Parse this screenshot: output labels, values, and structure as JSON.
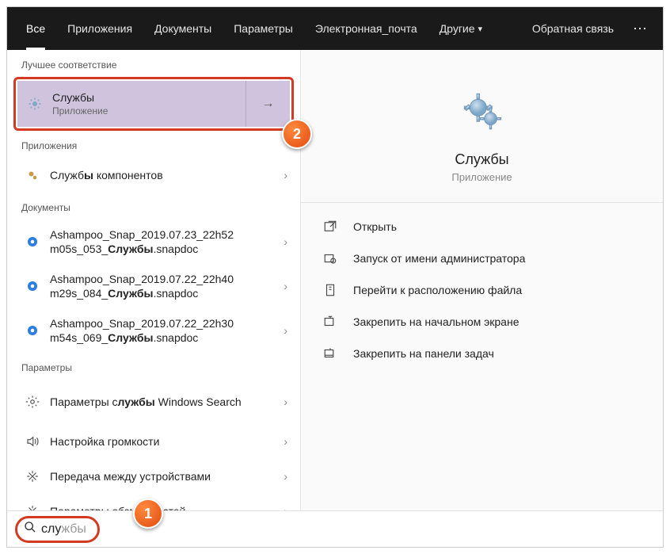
{
  "tabs": {
    "all": "Все",
    "apps": "Приложения",
    "docs": "Документы",
    "settings": "Параметры",
    "email": "Электронная_почта",
    "other": "Другие",
    "feedback": "Обратная связь"
  },
  "sections": {
    "best": "Лучшее соответствие",
    "apps": "Приложения",
    "docs": "Документы",
    "settings": "Параметры"
  },
  "best": {
    "title": "Службы",
    "sub": "Приложение"
  },
  "apps_list": [
    {
      "label_pre": "Служб",
      "label_bold": "ы",
      "label_post": " компонентов"
    }
  ],
  "docs_list": [
    {
      "line1": "Ashampoo_Snap_2019.07.23_22h52",
      "line2_pre": "m05s_053_",
      "line2_bold": "Службы",
      "line2_post": ".snapdoc"
    },
    {
      "line1": "Ashampoo_Snap_2019.07.22_22h40",
      "line2_pre": "m29s_084_",
      "line2_bold": "Службы",
      "line2_post": ".snapdoc"
    },
    {
      "line1": "Ashampoo_Snap_2019.07.22_22h30",
      "line2_pre": "m54s_069_",
      "line2_bold": "Службы",
      "line2_post": ".snapdoc"
    }
  ],
  "settings_list": [
    {
      "pre": "Параметры с",
      "bold": "лужбы",
      "post": " Windows Search"
    },
    {
      "pre": "Настройка громкости",
      "bold": "",
      "post": ""
    },
    {
      "pre": "Передача между устройствами",
      "bold": "",
      "post": ""
    },
    {
      "pre": "Параметры об",
      "bold": "",
      "post": "зможностей"
    }
  ],
  "preview": {
    "title": "Службы",
    "sub": "Приложение"
  },
  "actions": {
    "open": "Открыть",
    "admin": "Запуск от имени администратора",
    "location": "Перейти к расположению файла",
    "pin_start": "Закрепить на начальном экране",
    "pin_taskbar": "Закрепить на панели задач"
  },
  "search": {
    "typed": "слу",
    "ghost": "жбы"
  },
  "callouts": {
    "one": "1",
    "two": "2"
  }
}
